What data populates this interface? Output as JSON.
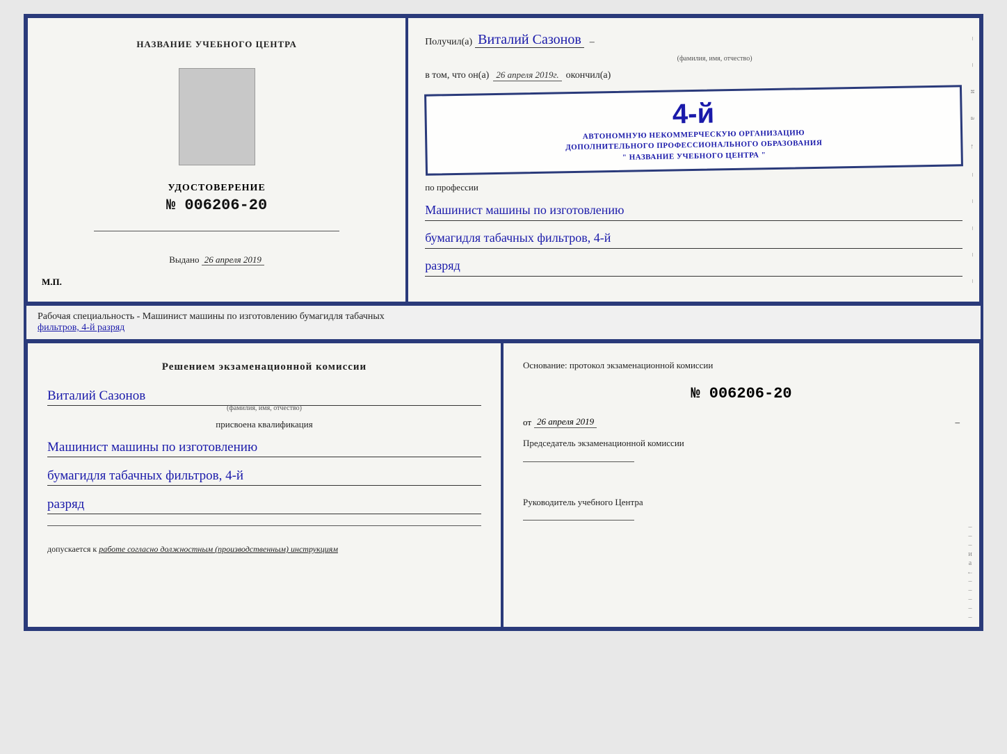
{
  "cert": {
    "left": {
      "center_name_label": "НАЗВАНИЕ УЧЕБНОГО ЦЕНТРА",
      "udost_label": "УДОСТОВЕРЕНИЕ",
      "udost_number": "№ 006206-20",
      "vydano_prefix": "Выдано",
      "vydano_date": "26 апреля 2019",
      "mp_label": "М.П."
    },
    "right": {
      "poluchil_prefix": "Получил(а)",
      "recipient_name": "Виталий Сазонов",
      "fio_sub": "(фамилия, имя, отчество)",
      "dash": "–",
      "vtom_prefix": "в том, что он(а)",
      "date_handwritten": "26 апреля 2019г.",
      "okonchil": "окончил(а)",
      "stamp_number": "4-й",
      "stamp_line1": "АВТОНОМНУЮ НЕКОММЕРЧЕСКУЮ ОРГАНИЗАЦИЮ",
      "stamp_line2": "ДОПОЛНИТЕЛЬНОГО ПРОФЕССИОНАЛЬНОГО ОБРАЗОВАНИЯ",
      "stamp_line3": "\" НАЗВАНИЕ УЧЕБНОГО ЦЕНТРА \"",
      "po_professii": "по профессии",
      "profession_line1": "Машинист машины по изготовлению",
      "profession_line2": "бумагидля табачных фильтров, 4-й",
      "profession_line3": "разряд"
    }
  },
  "middle_label": {
    "prefix": "Рабочая специальность - Машинист машины по изготовлению бумагидля табачных",
    "underlined": "фильтров, 4-й разряд"
  },
  "bottom": {
    "left": {
      "title": "Решением  экзаменационной  комиссии",
      "person_name": "Виталий Сазонов",
      "fio_sub": "(фамилия, имя, отчество)",
      "prisvoena": "присвоена квалификация",
      "qual_line1": "Машинист машины по изготовлению",
      "qual_line2": "бумагидля табачных фильтров, 4-й",
      "qual_line3": "разряд",
      "dopuskaetsya_prefix": "допускается к",
      "dopuskaetsya_val": "работе согласно должностным (производственным) инструкциям"
    },
    "right": {
      "osnovanie": "Основание: протокол экзаменационной  комиссии",
      "protocol_number": "№  006206-20",
      "ot_prefix": "от",
      "ot_date": "26 апреля 2019",
      "predsedatel_label": "Председатель экзаменационной комиссии",
      "rukovoditel_label": "Руководитель учебного Центра",
      "right_i": "и",
      "right_a": "а",
      "right_arrow": "←",
      "dashes": [
        "–",
        "–",
        "–",
        "–",
        "–",
        "–",
        "–",
        "–"
      ]
    }
  }
}
